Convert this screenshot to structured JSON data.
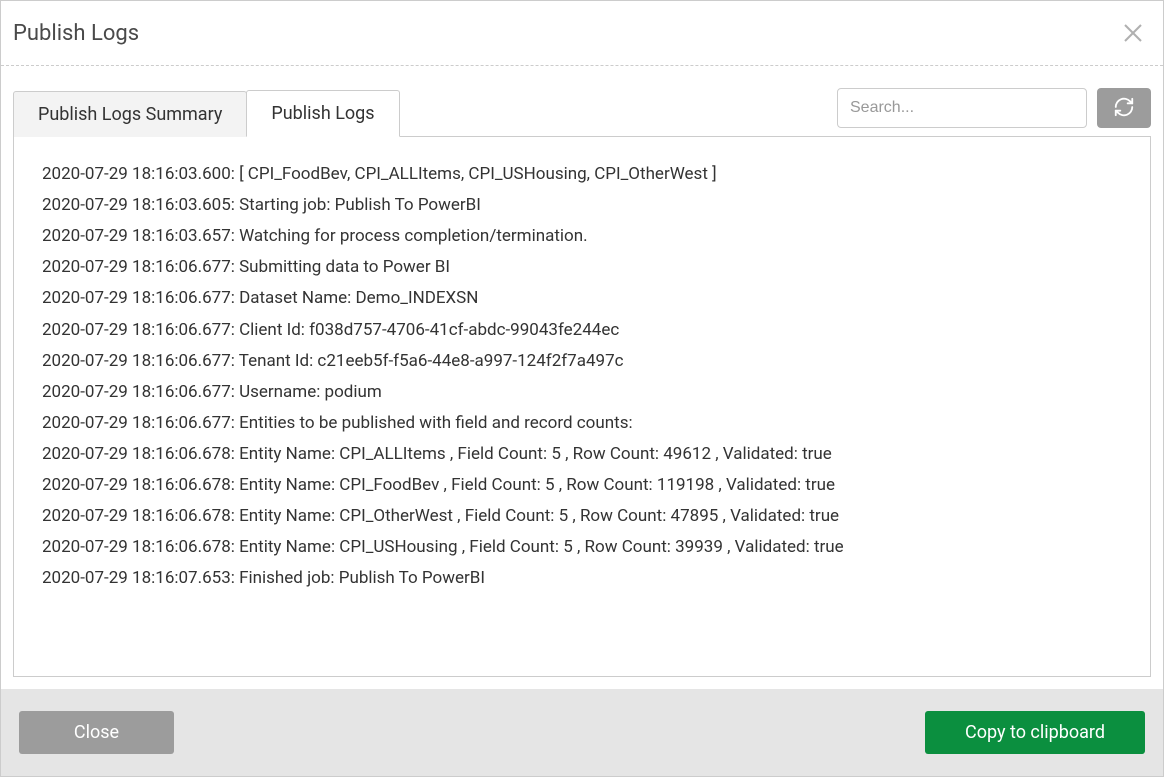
{
  "dialog": {
    "title": "Publish Logs"
  },
  "tabs": {
    "summary": "Publish Logs Summary",
    "logs": "Publish Logs"
  },
  "search": {
    "placeholder": "Search..."
  },
  "log_lines": [
    "2020-07-29 18:16:03.600: [ CPI_FoodBev, CPI_ALLItems, CPI_USHousing, CPI_OtherWest ]",
    "2020-07-29 18:16:03.605: Starting job: Publish To PowerBI",
    "2020-07-29 18:16:03.657: Watching for process completion/termination.",
    "2020-07-29 18:16:06.677: Submitting data to Power BI",
    "2020-07-29 18:16:06.677: Dataset Name: Demo_INDEXSN",
    "2020-07-29 18:16:06.677: Client Id: f038d757-4706-41cf-abdc-99043fe244ec",
    "2020-07-29 18:16:06.677: Tenant Id: c21eeb5f-f5a6-44e8-a997-124f2f7a497c",
    "2020-07-29 18:16:06.677: Username: podium",
    "2020-07-29 18:16:06.677: Entities to be published with field and record counts:",
    "2020-07-29 18:16:06.678: Entity Name: CPI_ALLItems , Field Count: 5 , Row Count: 49612 , Validated: true",
    "2020-07-29 18:16:06.678: Entity Name: CPI_FoodBev , Field Count: 5 , Row Count: 119198 , Validated: true",
    "2020-07-29 18:16:06.678: Entity Name: CPI_OtherWest , Field Count: 5 , Row Count: 47895 , Validated: true",
    "2020-07-29 18:16:06.678: Entity Name: CPI_USHousing , Field Count: 5 , Row Count: 39939 , Validated: true",
    "2020-07-29 18:16:07.653: Finished job: Publish To PowerBI"
  ],
  "footer": {
    "close": "Close",
    "copy": "Copy to clipboard"
  }
}
